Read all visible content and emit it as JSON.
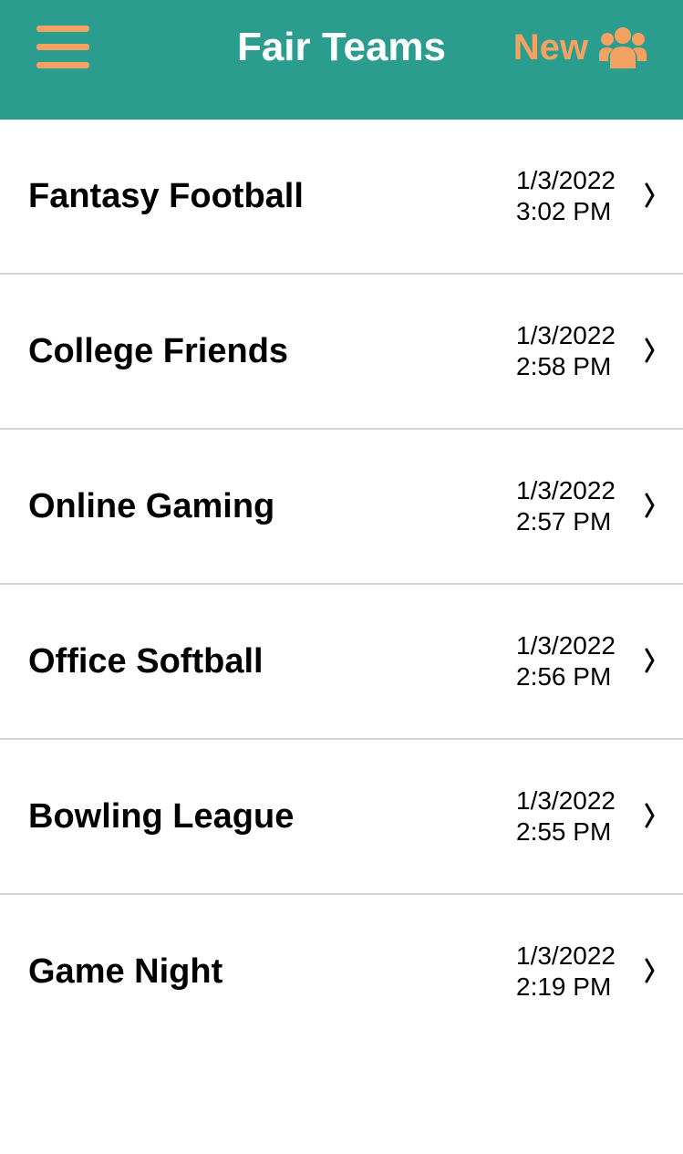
{
  "header": {
    "title": "Fair Teams",
    "new_label": "New",
    "menu_icon": "hamburger-menu-icon",
    "new_icon": "users-group-icon",
    "background_color": "#2a9d8f",
    "accent_color": "#f4a261"
  },
  "groups": [
    {
      "name": "Fantasy Football",
      "date": "1/3/2022",
      "time": "3:02 PM"
    },
    {
      "name": "College Friends",
      "date": "1/3/2022",
      "time": "2:58 PM"
    },
    {
      "name": "Online Gaming",
      "date": "1/3/2022",
      "time": "2:57 PM"
    },
    {
      "name": "Office Softball",
      "date": "1/3/2022",
      "time": "2:56 PM"
    },
    {
      "name": "Bowling League",
      "date": "1/3/2022",
      "time": "2:55 PM"
    },
    {
      "name": "Game Night",
      "date": "1/3/2022",
      "time": "2:19 PM"
    }
  ]
}
